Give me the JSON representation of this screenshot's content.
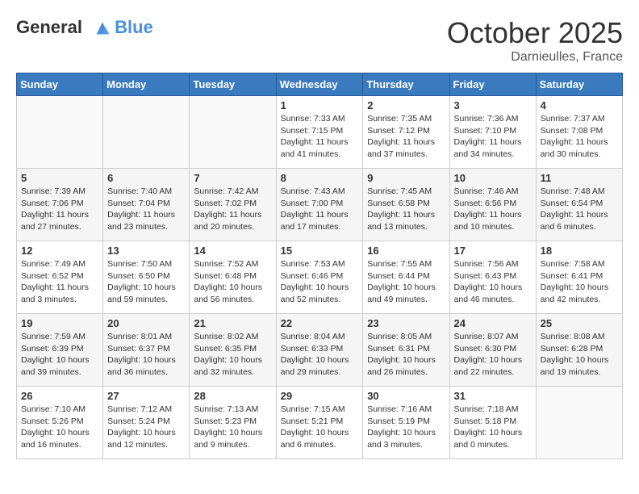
{
  "header": {
    "logo_line1": "General",
    "logo_line2": "Blue",
    "month": "October 2025",
    "location": "Darnieulles, France"
  },
  "weekdays": [
    "Sunday",
    "Monday",
    "Tuesday",
    "Wednesday",
    "Thursday",
    "Friday",
    "Saturday"
  ],
  "weeks": [
    [
      {
        "day": "",
        "info": ""
      },
      {
        "day": "",
        "info": ""
      },
      {
        "day": "",
        "info": ""
      },
      {
        "day": "1",
        "info": "Sunrise: 7:33 AM\nSunset: 7:15 PM\nDaylight: 11 hours\nand 41 minutes."
      },
      {
        "day": "2",
        "info": "Sunrise: 7:35 AM\nSunset: 7:12 PM\nDaylight: 11 hours\nand 37 minutes."
      },
      {
        "day": "3",
        "info": "Sunrise: 7:36 AM\nSunset: 7:10 PM\nDaylight: 11 hours\nand 34 minutes."
      },
      {
        "day": "4",
        "info": "Sunrise: 7:37 AM\nSunset: 7:08 PM\nDaylight: 11 hours\nand 30 minutes."
      }
    ],
    [
      {
        "day": "5",
        "info": "Sunrise: 7:39 AM\nSunset: 7:06 PM\nDaylight: 11 hours\nand 27 minutes."
      },
      {
        "day": "6",
        "info": "Sunrise: 7:40 AM\nSunset: 7:04 PM\nDaylight: 11 hours\nand 23 minutes."
      },
      {
        "day": "7",
        "info": "Sunrise: 7:42 AM\nSunset: 7:02 PM\nDaylight: 11 hours\nand 20 minutes."
      },
      {
        "day": "8",
        "info": "Sunrise: 7:43 AM\nSunset: 7:00 PM\nDaylight: 11 hours\nand 17 minutes."
      },
      {
        "day": "9",
        "info": "Sunrise: 7:45 AM\nSunset: 6:58 PM\nDaylight: 11 hours\nand 13 minutes."
      },
      {
        "day": "10",
        "info": "Sunrise: 7:46 AM\nSunset: 6:56 PM\nDaylight: 11 hours\nand 10 minutes."
      },
      {
        "day": "11",
        "info": "Sunrise: 7:48 AM\nSunset: 6:54 PM\nDaylight: 11 hours\nand 6 minutes."
      }
    ],
    [
      {
        "day": "12",
        "info": "Sunrise: 7:49 AM\nSunset: 6:52 PM\nDaylight: 11 hours\nand 3 minutes."
      },
      {
        "day": "13",
        "info": "Sunrise: 7:50 AM\nSunset: 6:50 PM\nDaylight: 10 hours\nand 59 minutes."
      },
      {
        "day": "14",
        "info": "Sunrise: 7:52 AM\nSunset: 6:48 PM\nDaylight: 10 hours\nand 56 minutes."
      },
      {
        "day": "15",
        "info": "Sunrise: 7:53 AM\nSunset: 6:46 PM\nDaylight: 10 hours\nand 52 minutes."
      },
      {
        "day": "16",
        "info": "Sunrise: 7:55 AM\nSunset: 6:44 PM\nDaylight: 10 hours\nand 49 minutes."
      },
      {
        "day": "17",
        "info": "Sunrise: 7:56 AM\nSunset: 6:43 PM\nDaylight: 10 hours\nand 46 minutes."
      },
      {
        "day": "18",
        "info": "Sunrise: 7:58 AM\nSunset: 6:41 PM\nDaylight: 10 hours\nand 42 minutes."
      }
    ],
    [
      {
        "day": "19",
        "info": "Sunrise: 7:59 AM\nSunset: 6:39 PM\nDaylight: 10 hours\nand 39 minutes."
      },
      {
        "day": "20",
        "info": "Sunrise: 8:01 AM\nSunset: 6:37 PM\nDaylight: 10 hours\nand 36 minutes."
      },
      {
        "day": "21",
        "info": "Sunrise: 8:02 AM\nSunset: 6:35 PM\nDaylight: 10 hours\nand 32 minutes."
      },
      {
        "day": "22",
        "info": "Sunrise: 8:04 AM\nSunset: 6:33 PM\nDaylight: 10 hours\nand 29 minutes."
      },
      {
        "day": "23",
        "info": "Sunrise: 8:05 AM\nSunset: 6:31 PM\nDaylight: 10 hours\nand 26 minutes."
      },
      {
        "day": "24",
        "info": "Sunrise: 8:07 AM\nSunset: 6:30 PM\nDaylight: 10 hours\nand 22 minutes."
      },
      {
        "day": "25",
        "info": "Sunrise: 8:08 AM\nSunset: 6:28 PM\nDaylight: 10 hours\nand 19 minutes."
      }
    ],
    [
      {
        "day": "26",
        "info": "Sunrise: 7:10 AM\nSunset: 5:26 PM\nDaylight: 10 hours\nand 16 minutes."
      },
      {
        "day": "27",
        "info": "Sunrise: 7:12 AM\nSunset: 5:24 PM\nDaylight: 10 hours\nand 12 minutes."
      },
      {
        "day": "28",
        "info": "Sunrise: 7:13 AM\nSunset: 5:23 PM\nDaylight: 10 hours\nand 9 minutes."
      },
      {
        "day": "29",
        "info": "Sunrise: 7:15 AM\nSunset: 5:21 PM\nDaylight: 10 hours\nand 6 minutes."
      },
      {
        "day": "30",
        "info": "Sunrise: 7:16 AM\nSunset: 5:19 PM\nDaylight: 10 hours\nand 3 minutes."
      },
      {
        "day": "31",
        "info": "Sunrise: 7:18 AM\nSunset: 5:18 PM\nDaylight: 10 hours\nand 0 minutes."
      },
      {
        "day": "",
        "info": ""
      }
    ]
  ]
}
